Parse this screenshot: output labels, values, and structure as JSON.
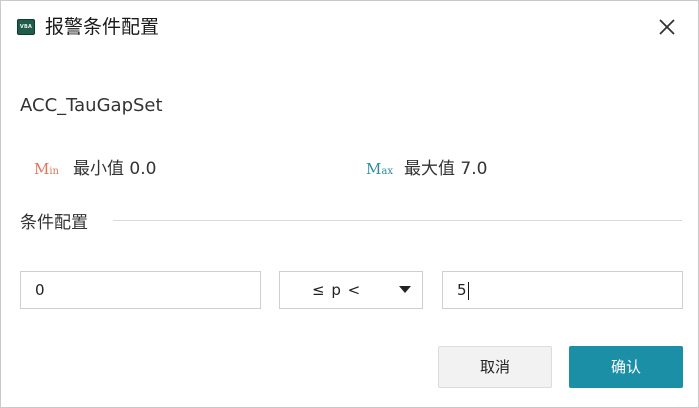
{
  "window": {
    "title": "报警条件配置",
    "icon_name": "app-logo-icon",
    "icon_text": "VBA",
    "close_icon": "close-icon"
  },
  "signal": {
    "name": "ACC_TauGapSet"
  },
  "range": {
    "min_icon_main": "M",
    "min_icon_sub": "in",
    "min_text": "最小值 0.0",
    "max_icon_main": "M",
    "max_icon_sub": "ax",
    "max_text": "最大值 7.0"
  },
  "condition": {
    "section_title": "条件配置",
    "lower_value": "0",
    "operator": "≤ p <",
    "upper_value": "5"
  },
  "buttons": {
    "cancel_label": "取消",
    "confirm_label": "确认"
  },
  "colors": {
    "min_accent": "#e2735a",
    "max_accent": "#2a8aa6",
    "primary": "#1b8fa5"
  }
}
